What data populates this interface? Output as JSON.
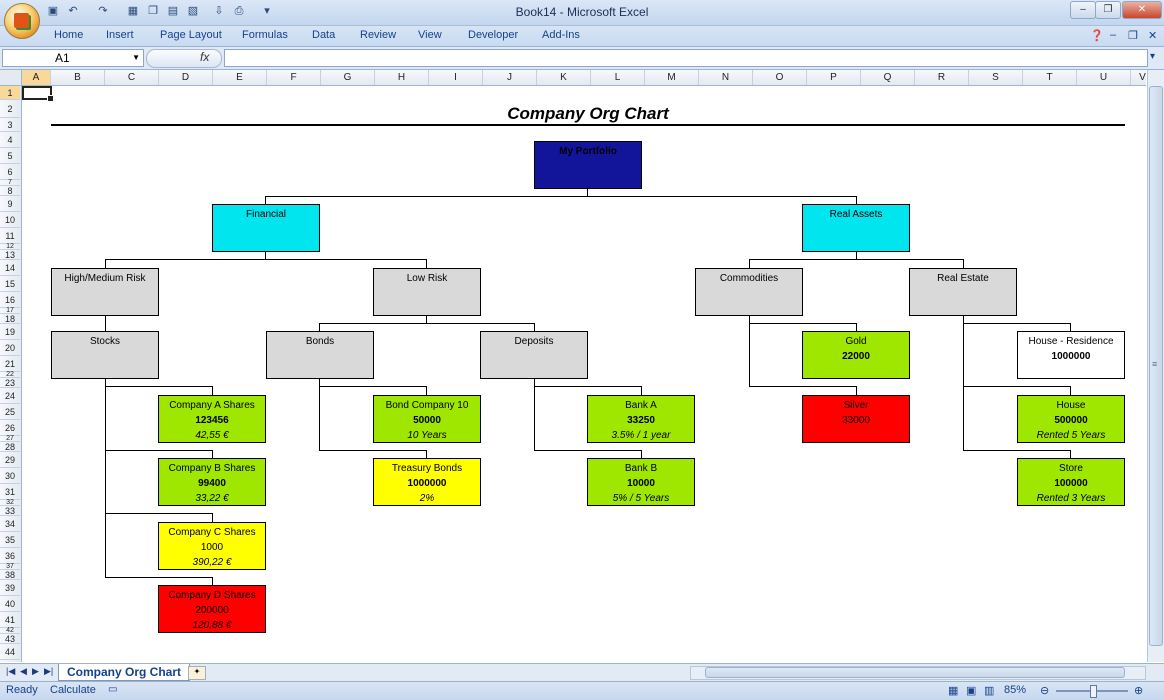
{
  "window": {
    "title": "Book14 - Microsoft Excel"
  },
  "ribbon_tabs": [
    "Home",
    "Insert",
    "Page Layout",
    "Formulas",
    "Data",
    "Review",
    "View",
    "Developer",
    "Add-Ins"
  ],
  "formula_bar": {
    "name_box": "A1",
    "fx_label": "fx",
    "formula": ""
  },
  "columns": [
    "A",
    "B",
    "C",
    "D",
    "E",
    "F",
    "G",
    "H",
    "I",
    "J",
    "K",
    "L",
    "M",
    "N",
    "O",
    "P",
    "Q",
    "R",
    "S",
    "T",
    "U",
    "V"
  ],
  "rows": [
    "1",
    "2",
    "3",
    "4",
    "5",
    "6",
    "7",
    "8",
    "9",
    "10",
    "11",
    "12",
    "13",
    "14",
    "15",
    "16",
    "17",
    "18",
    "19",
    "20",
    "21",
    "22",
    "23",
    "24",
    "25",
    "26",
    "27",
    "28",
    "29",
    "30",
    "31",
    "32",
    "33",
    "34",
    "35",
    "36",
    "37",
    "38",
    "39",
    "40",
    "41",
    "42",
    "43",
    "44"
  ],
  "chart": {
    "title": "Company Org Chart",
    "nodes": {
      "portfolio": {
        "label": "My Portfolio",
        "color": "#12149a"
      },
      "financial": {
        "label": "Financial",
        "color": "#00e5ee"
      },
      "real_assets": {
        "label": "Real Assets",
        "color": "#00e5ee"
      },
      "high_medium_risk": {
        "label": "High/Medium Risk",
        "color": "#d9d9d9"
      },
      "low_risk": {
        "label": "Low Risk",
        "color": "#d9d9d9"
      },
      "commodities": {
        "label": "Commodities",
        "color": "#d9d9d9"
      },
      "real_estate": {
        "label": "Real Estate",
        "color": "#d9d9d9"
      },
      "stocks": {
        "label": "Stocks",
        "color": "#d9d9d9"
      },
      "bonds": {
        "label": "Bonds",
        "color": "#d9d9d9"
      },
      "deposits": {
        "label": "Deposits",
        "color": "#d9d9d9"
      },
      "gold": {
        "label": "Gold",
        "value": "22000",
        "color": "#9fe600"
      },
      "house_residence": {
        "label": "House - Residence",
        "value": "1000000",
        "color": "#ffffff"
      },
      "company_a": {
        "label": "Company A Shares",
        "value": "123456",
        "note": "42,55 €",
        "color": "#9fe600"
      },
      "bond_company_10": {
        "label": "Bond Company 10",
        "value": "50000",
        "note": "10 Years",
        "color": "#9fe600"
      },
      "bank_a": {
        "label": "Bank A",
        "value": "33250",
        "note": "3.5% / 1 year",
        "color": "#9fe600"
      },
      "silver": {
        "label": "Silver",
        "value": "33000",
        "color": "#ff0000"
      },
      "house": {
        "label": "House",
        "value": "500000",
        "note": "Rented 5 Years",
        "color": "#9fe600"
      },
      "company_b": {
        "label": "Company B Shares",
        "value": "99400",
        "note": "33,22 €",
        "color": "#9fe600"
      },
      "treasury_bonds": {
        "label": "Treasury Bonds",
        "value": "1000000",
        "note": "2%",
        "color": "#ffff00"
      },
      "bank_b": {
        "label": "Bank B",
        "value": "10000",
        "note": "5% / 5 Years",
        "color": "#9fe600"
      },
      "store": {
        "label": "Store",
        "value": "100000",
        "note": "Rented 3 Years",
        "color": "#9fe600"
      },
      "company_c": {
        "label": "Company C Shares",
        "value": "1000",
        "note": "390,22 €",
        "color": "#ffff00"
      },
      "company_d": {
        "label": "Company D Shares",
        "value": "200000",
        "note": "120,88 €",
        "color": "#ff0000"
      }
    }
  },
  "sheet_tab": "Company Org Chart",
  "status": {
    "ready": "Ready",
    "calculate": "Calculate",
    "zoom": "85%"
  }
}
